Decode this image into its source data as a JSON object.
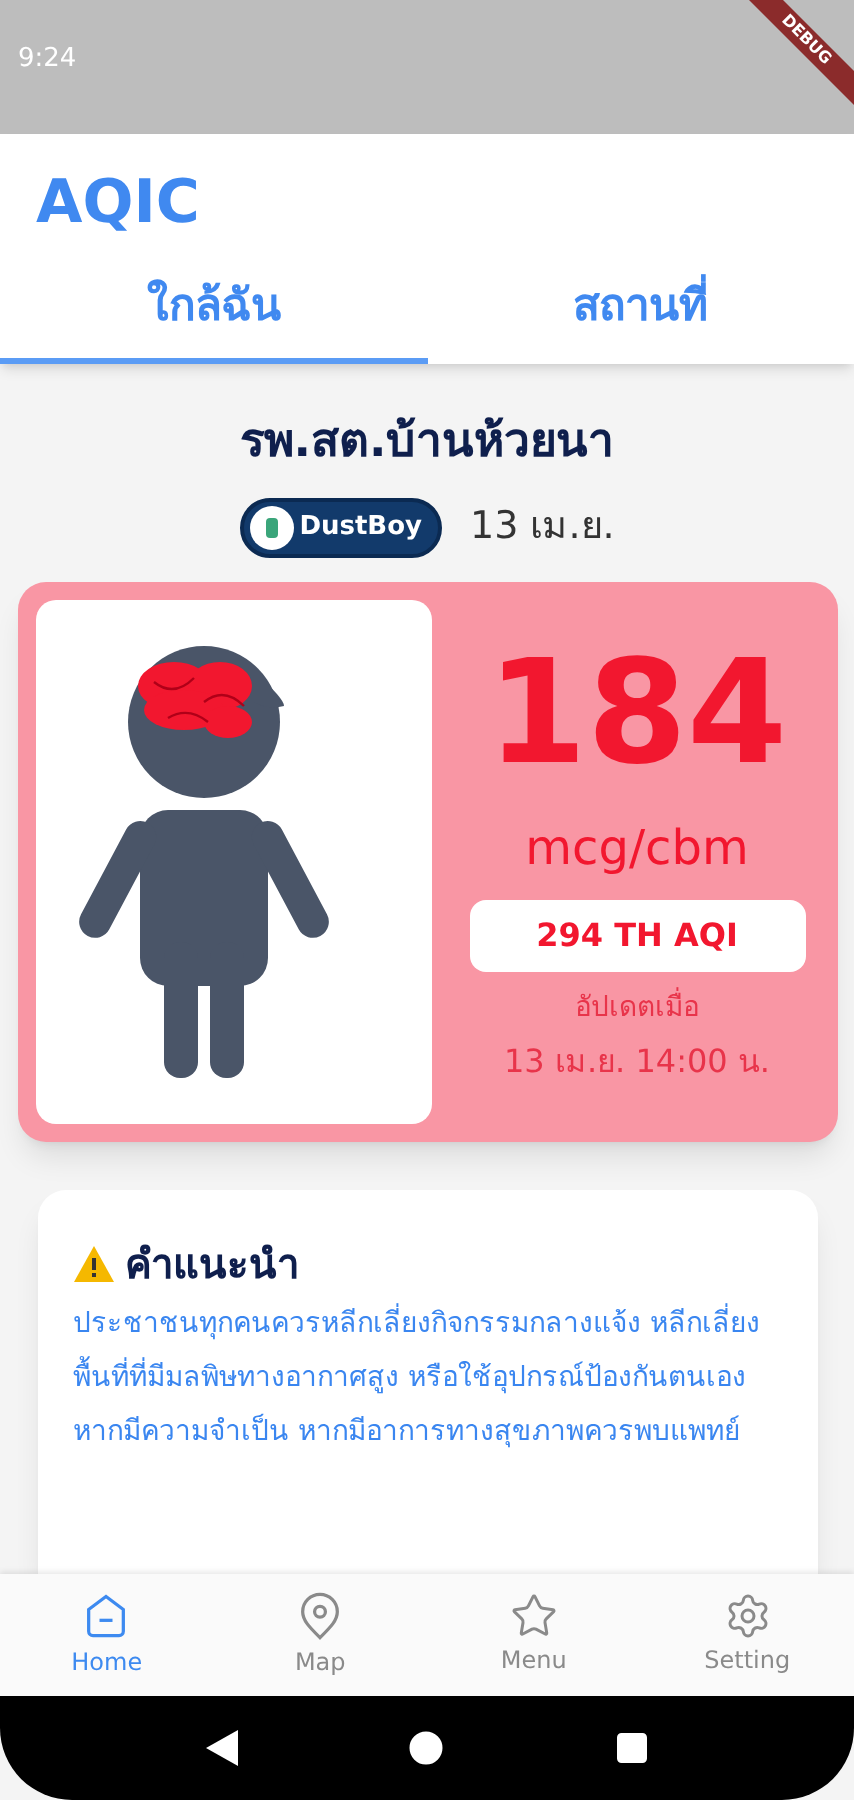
{
  "status_bar": {
    "time": "9:24"
  },
  "debug_banner": "DEBUG",
  "app_bar": {
    "title": "AQIC"
  },
  "tabs": [
    {
      "label": "ใกล้ฉัน",
      "selected": true
    },
    {
      "label": "สถานที่",
      "selected": false
    }
  ],
  "station": {
    "name": "รพ.สต.บ้านห้วยนา",
    "source": "DustBoy",
    "date": "13 เม.ย."
  },
  "reading": {
    "value": "184",
    "unit": "mcg/cbm",
    "aqi": "294 TH AQI",
    "updated_label": "อัปเดตเมื่อ",
    "updated_time": "13 เม.ย. 14:00 น."
  },
  "advice": {
    "title": "คำแนะนำ",
    "text": "ประชาชนทุกคนควรหลีกเลี่ยงกิจกรรมกลางแจ้ง หลีกเลี่ยงพื้นที่ที่มีมลพิษทางอากาศสูง หรือใช้อุปกรณ์ป้องกันตนเองหากมีความจำเป็น หากมีอาการทางสุขภาพควรพบแพทย์"
  },
  "bottom_nav": [
    {
      "label": "Home",
      "selected": true
    },
    {
      "label": "Map",
      "selected": false
    },
    {
      "label": "Menu",
      "selected": false
    },
    {
      "label": "Setting",
      "selected": false
    }
  ]
}
